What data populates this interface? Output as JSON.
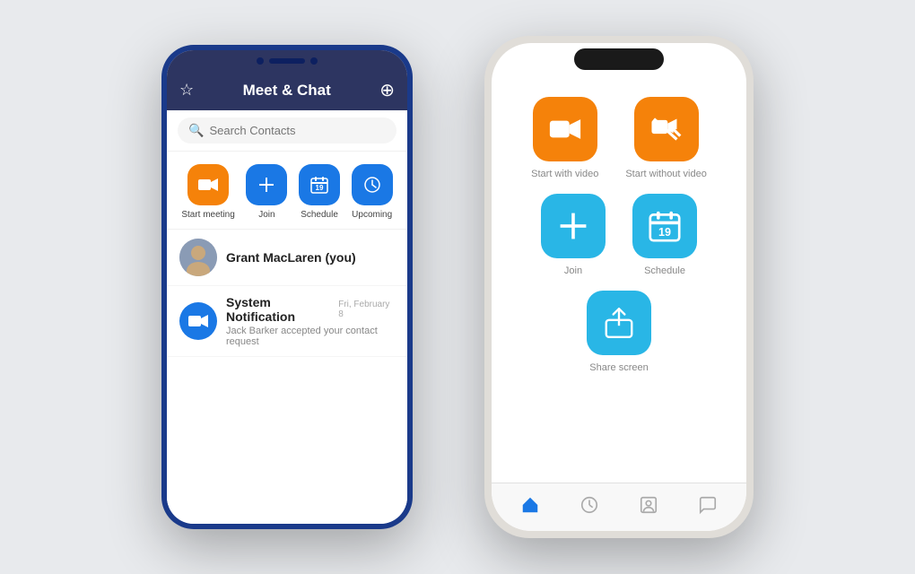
{
  "left_phone": {
    "header": {
      "title": "Meet & Chat",
      "star_icon": "☆",
      "add_icon": "⊕"
    },
    "search": {
      "placeholder": "Search Contacts"
    },
    "action_buttons": [
      {
        "id": "start-meeting",
        "label": "Start meeting",
        "color": "orange",
        "icon": "video"
      },
      {
        "id": "join",
        "label": "Join",
        "color": "blue",
        "icon": "plus"
      },
      {
        "id": "schedule",
        "label": "Schedule",
        "color": "blue",
        "icon": "calendar"
      },
      {
        "id": "upcoming",
        "label": "Upcoming",
        "color": "blue",
        "icon": "clock"
      }
    ],
    "contacts": [
      {
        "id": "grant",
        "name": "Grant MacLaren (you)",
        "sub": "",
        "date": "",
        "avatar_type": "person"
      },
      {
        "id": "system",
        "name": "System Notification",
        "sub": "Jack Barker accepted your contact request",
        "date": "Fri, February 8",
        "avatar_type": "icon"
      }
    ]
  },
  "right_phone": {
    "action_buttons": [
      {
        "id": "start-with-video",
        "label": "Start with video",
        "color": "orange",
        "icon": "video"
      },
      {
        "id": "start-without-video",
        "label": "Start without video",
        "color": "orange",
        "icon": "video-off"
      },
      {
        "id": "join",
        "label": "Join",
        "color": "blue",
        "icon": "plus"
      },
      {
        "id": "schedule",
        "label": "Schedule",
        "color": "blue",
        "icon": "calendar"
      },
      {
        "id": "share-screen",
        "label": "Share screen",
        "color": "blue",
        "icon": "share"
      }
    ],
    "bottom_tabs": [
      {
        "id": "home",
        "icon": "🏠",
        "active": true
      },
      {
        "id": "clock",
        "icon": "🕐",
        "active": false
      },
      {
        "id": "contacts",
        "icon": "👤",
        "active": false
      },
      {
        "id": "chat",
        "icon": "💬",
        "active": false
      }
    ]
  }
}
